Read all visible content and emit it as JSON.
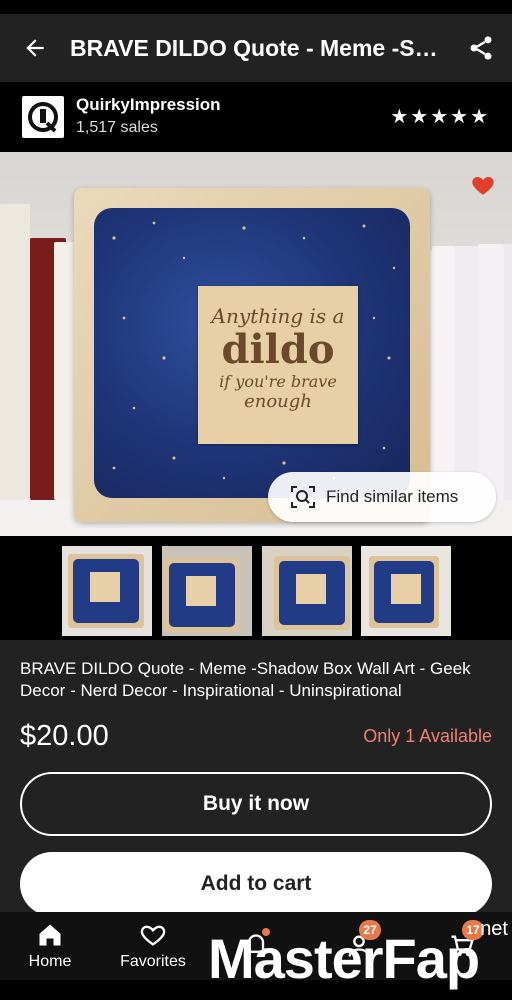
{
  "header": {
    "title": "BRAVE DILDO Quote - Meme -Shadow Box Wall Art - Geek Decor - Nerd Decor - Inspirational - Uninspirational",
    "back_icon": "arrow-left-icon",
    "share_icon": "share-icon"
  },
  "shop": {
    "name": "QuirkyImpression",
    "sales": "1,517 sales",
    "rating": 5,
    "stars": [
      "★",
      "★",
      "★",
      "★",
      "★"
    ]
  },
  "hero": {
    "plaque_line1": "Anything is a",
    "plaque_line2": "dildo",
    "plaque_line3": "if you're brave",
    "plaque_line4": "enough",
    "find_similar_label": "Find similar items"
  },
  "thumbnails": {
    "count": 4
  },
  "product": {
    "title": "BRAVE DILDO Quote - Meme -Shadow Box Wall Art - Geek Decor - Nerd Decor - Inspirational - Uninspirational",
    "price": "$20.00",
    "availability": "Only 1 Available",
    "buy_now_label": "Buy it now",
    "add_to_cart_label": "Add to cart"
  },
  "tabs": {
    "home": "Home",
    "favorites": "Favorites",
    "updates_badge": "27",
    "cart_badge": "17"
  },
  "watermark": {
    "brand": "MasterFap",
    "suffix": "net"
  },
  "colors": {
    "accent_badge": "#e87a4a",
    "availability": "#f08070"
  }
}
